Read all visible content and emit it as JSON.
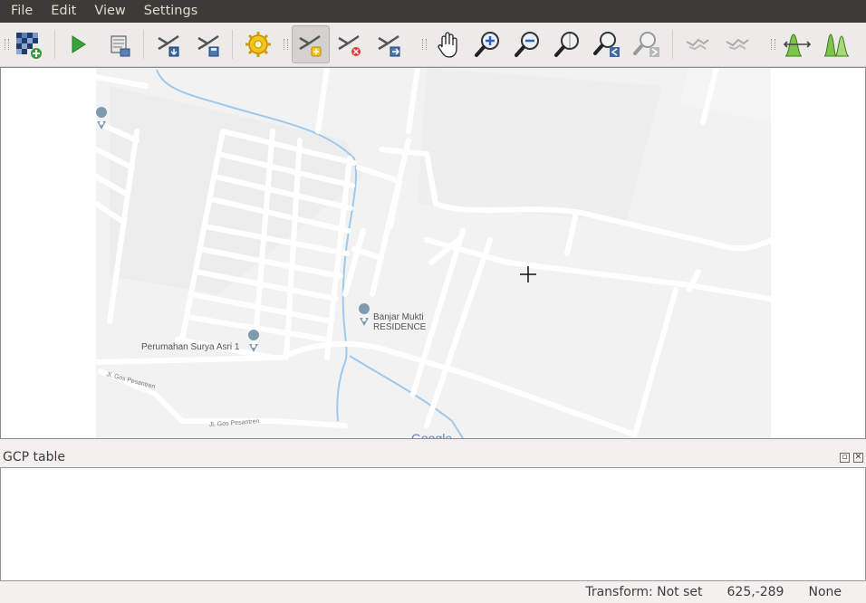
{
  "menubar": {
    "file": "File",
    "edit": "Edit",
    "view": "View",
    "settings": "Settings"
  },
  "toolbar": {
    "open_raster": "open-raster-icon",
    "start_georef": "start-georeferencing-icon",
    "generate_script": "generate-gdal-script-icon",
    "load_gcp": "load-gcp-points-icon",
    "save_gcp": "save-gcp-points-icon",
    "transform_settings": "transformation-settings-icon",
    "add_point": "add-point-icon",
    "delete_point": "delete-point-icon",
    "move_gcp": "move-gcp-point-icon",
    "pan": "pan-icon",
    "zoom_in": "zoom-in-icon",
    "zoom_out": "zoom-out-icon",
    "zoom_layer": "zoom-to-layer-icon",
    "zoom_last": "zoom-last-icon",
    "zoom_next": "zoom-next-icon",
    "link_georef_qgis": "link-georeferencer-to-qgis-icon",
    "link_qgis_georef": "link-qgis-to-georeferencer-icon",
    "full_histogram": "full-histogram-stretch-icon",
    "local_histogram": "local-histogram-stretch-icon"
  },
  "map": {
    "labels": {
      "banjar": "Banjar Mukti",
      "residence": "RESIDENCE",
      "surya": "Perumahan Surya Asri 1",
      "road1": "Jl. Gos Pesantren",
      "road2": "Jl. Gos Pesantren",
      "google": "Google"
    }
  },
  "gcp_panel": {
    "title": "GCP table"
  },
  "statusbar": {
    "transform": "Transform: Not set",
    "coords": "625,-289",
    "crs": "None"
  },
  "colors": {
    "menubar_bg": "#3c3b37",
    "map_bg": "#f2f2f2",
    "road": "#ffffff",
    "water": "#9dc9ee",
    "pin": "#7d9cb0"
  }
}
